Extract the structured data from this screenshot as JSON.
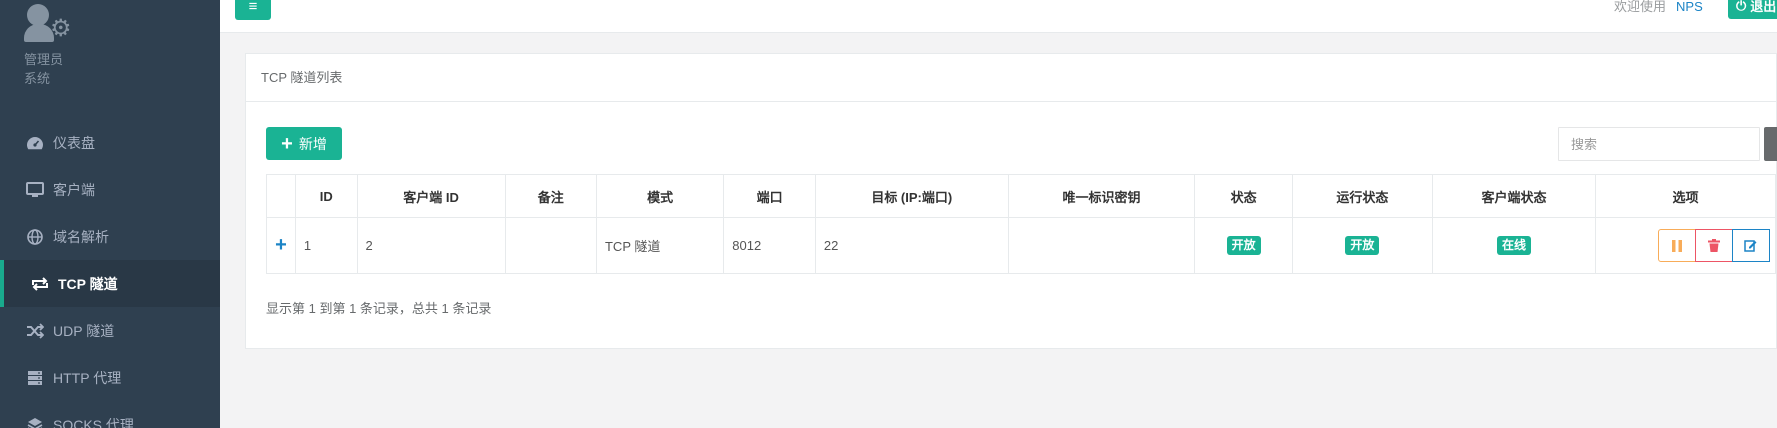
{
  "sidebar": {
    "role_line1": "管理员",
    "role_line2": "系统",
    "items": [
      {
        "label": "仪表盘",
        "icon": "dashboard-icon"
      },
      {
        "label": "客户端",
        "icon": "monitor-icon"
      },
      {
        "label": "域名解析",
        "icon": "globe-icon"
      },
      {
        "label": "TCP 隧道",
        "icon": "exchange-icon",
        "active": true
      },
      {
        "label": "UDP 隧道",
        "icon": "random-icon"
      },
      {
        "label": "HTTP 代理",
        "icon": "server-icon"
      },
      {
        "label": "SOCKS 代理",
        "icon": "layers-icon"
      }
    ]
  },
  "topbar": {
    "menu_icon": "≡",
    "welcome": "欢迎使用",
    "brand": "NPS",
    "exit_label": "退出"
  },
  "panel": {
    "title": "TCP 隧道列表",
    "add_label": "新增",
    "search_placeholder": "搜索",
    "summary": "显示第 1 到第 1 条记录，总共 1 条记录"
  },
  "table": {
    "columns": [
      "",
      "ID",
      "客户端 ID",
      "备注",
      "模式",
      "端口",
      "目标 (IP:端口)",
      "唯一标识密钥",
      "状态",
      "运行状态",
      "客户端状态",
      "选项"
    ],
    "rows": [
      {
        "id": "1",
        "client_id": "2",
        "remark": "",
        "mode": "TCP 隧道",
        "port": "8012",
        "target": "22",
        "key": "",
        "status": "开放",
        "run_status": "开放",
        "client_status": "在线"
      }
    ]
  },
  "colors": {
    "accent": "#1ab394",
    "sidebar": "#2f4050",
    "warning": "#f8ac59",
    "danger": "#ed5565",
    "link": "#1c84c6"
  }
}
